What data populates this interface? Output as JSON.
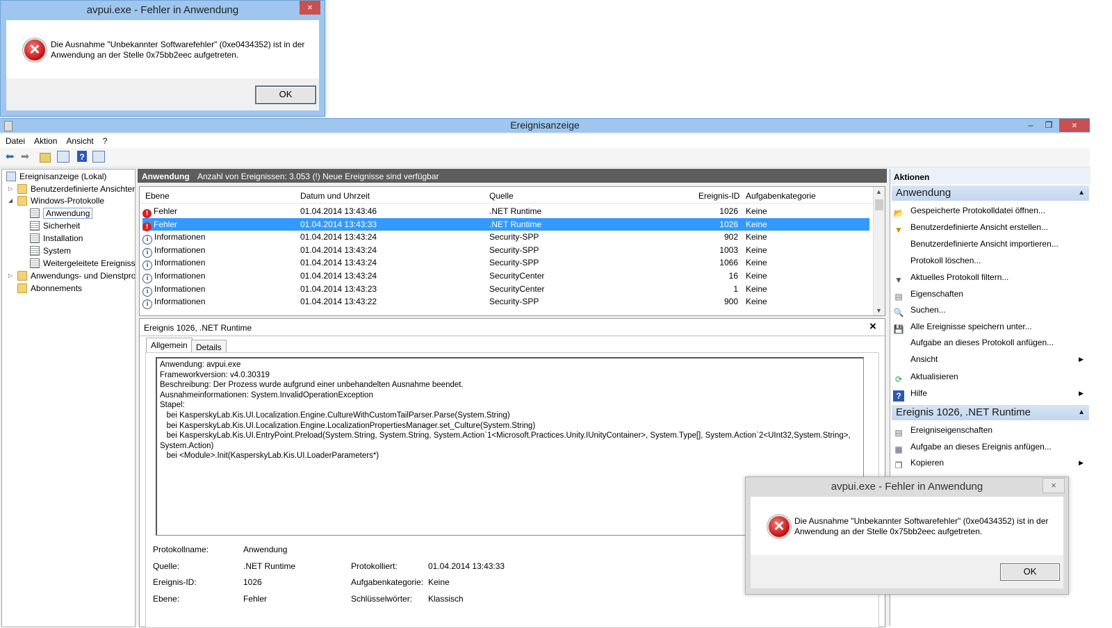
{
  "dialog_top": {
    "title": "avpui.exe - Fehler in Anwendung",
    "close": "×",
    "message_line1": "Die Ausnahme \"Unbekannter Softwarefehler\" (0xe0434352) ist in der",
    "message_line2": "Anwendung an der Stelle 0x75bb2eec aufgetreten.",
    "ok_label": "OK"
  },
  "dialog_bottom": {
    "title": "avpui.exe - Fehler in Anwendung",
    "close": "×",
    "message_line1": "Die Ausnahme \"Unbekannter Softwarefehler\" (0xe0434352) ist in der",
    "message_line2": "Anwendung an der Stelle 0x75bb2eec aufgetreten.",
    "ok_label": "OK"
  },
  "window": {
    "title": "Ereignisanzeige",
    "minimize": "–",
    "restore": "❐",
    "close": "×"
  },
  "menu": [
    "Datei",
    "Aktion",
    "Ansicht",
    "?"
  ],
  "tree": {
    "root": "Ereignisanzeige (Lokal)",
    "custom_views": "Benutzerdefinierte Ansichten",
    "windows_logs": "Windows-Protokolle",
    "logs": [
      "Anwendung",
      "Sicherheit",
      "Installation",
      "System",
      "Weitergeleitete Ereignisse"
    ],
    "app_service_logs": "Anwendungs- und Dienstprotokolle",
    "subscriptions": "Abonnements"
  },
  "center": {
    "header_title": "Anwendung",
    "header_info": "Anzahl von Ereignissen: 3.053 (!) Neue Ereignisse sind verfügbar",
    "columns": [
      "Ebene",
      "Datum und Uhrzeit",
      "Quelle",
      "Ereignis-ID",
      "Aufgabenkategorie"
    ],
    "rows": [
      {
        "level": "Fehler",
        "date": "01.04.2014 13:43:46",
        "source": ".NET Runtime",
        "id": "1026",
        "task": "Keine",
        "type": "error"
      },
      {
        "level": "Fehler",
        "date": "01.04.2014 13:43:33",
        "source": ".NET Runtime",
        "id": "1026",
        "task": "Keine",
        "type": "error"
      },
      {
        "level": "Informationen",
        "date": "01.04.2014 13:43:24",
        "source": "Security-SPP",
        "id": "902",
        "task": "Keine",
        "type": "info"
      },
      {
        "level": "Informationen",
        "date": "01.04.2014 13:43:24",
        "source": "Security-SPP",
        "id": "1003",
        "task": "Keine",
        "type": "info"
      },
      {
        "level": "Informationen",
        "date": "01.04.2014 13:43:24",
        "source": "Security-SPP",
        "id": "1066",
        "task": "Keine",
        "type": "info"
      },
      {
        "level": "Informationen",
        "date": "01.04.2014 13:43:24",
        "source": "SecurityCenter",
        "id": "16",
        "task": "Keine",
        "type": "info"
      },
      {
        "level": "Informationen",
        "date": "01.04.2014 13:43:23",
        "source": "SecurityCenter",
        "id": "1",
        "task": "Keine",
        "type": "info"
      },
      {
        "level": "Informationen",
        "date": "01.04.2014 13:43:22",
        "source": "Security-SPP",
        "id": "900",
        "task": "Keine",
        "type": "info"
      }
    ],
    "selected_row": 1
  },
  "detail": {
    "title": "Ereignis 1026, .NET Runtime",
    "close": "×",
    "tab_general": "Allgemein",
    "tab_details": "Details",
    "description": "Anwendung: avpui.exe\nFrameworkversion: v4.0.30319\nBeschreibung: Der Prozess wurde aufgrund einer unbehandelten Ausnahme beendet.\nAusnahmeinformationen: System.InvalidOperationException\nStapel:\n   bei KasperskyLab.Kis.UI.Localization.Engine.CultureWithCustomTailParser.Parse(System.String)\n   bei KasperskyLab.Kis.UI.Localization.Engine.LocalizationPropertiesManager.set_Culture(System.String)\n   bei KasperskyLab.Kis.UI.EntryPoint.Preload(System.String, System.String, System.Action`1<Microsoft.Practices.Unity.IUnityContainer>, System.Type[], System.Action`2<UInt32,System.String>,\nSystem.Action)\n   bei <Module>.Init(KasperskyLab.Kis.UI.LoaderParameters*)",
    "fields": {
      "log_name_label": "Protokollname:",
      "log_name": "Anwendung",
      "source_label": "Quelle:",
      "source": ".NET Runtime",
      "logged_label": "Protokolliert:",
      "logged": "01.04.2014 13:43:33",
      "event_id_label": "Ereignis-ID:",
      "event_id": "1026",
      "task_label": "Aufgabenkategorie:",
      "task": "Keine",
      "level_label": "Ebene:",
      "level": "Fehler",
      "keywords_label": "Schlüsselwörter:",
      "keywords": "Klassisch"
    }
  },
  "actions": {
    "header": "Aktionen",
    "section1": "Anwendung",
    "items1": [
      "Gespeicherte Protokolldatei öffnen...",
      "Benutzerdefinierte Ansicht erstellen...",
      "Benutzerdefinierte Ansicht importieren...",
      "Protokoll löschen...",
      "Aktuelles Protokoll filtern...",
      "Eigenschaften",
      "Suchen...",
      "Alle Ereignisse speichern unter...",
      "Aufgabe an dieses Protokoll anfügen...",
      "Ansicht",
      "Aktualisieren",
      "Hilfe"
    ],
    "section2": "Ereignis 1026, .NET Runtime",
    "items2": [
      "Ereigniseigenschaften",
      "Aufgabe an dieses Ereignis anfügen...",
      "Kopieren"
    ]
  }
}
